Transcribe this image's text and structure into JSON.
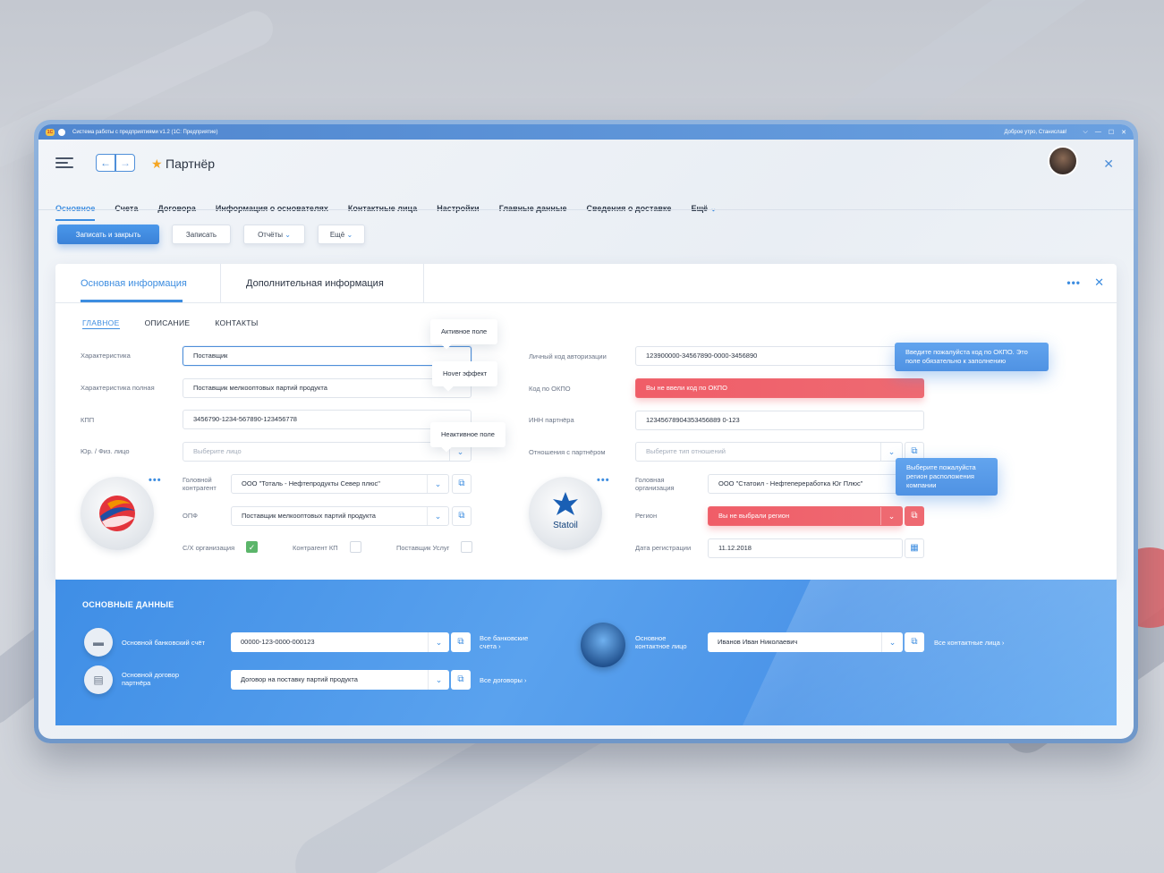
{
  "titlebar": {
    "logo": "1C",
    "title": "Система работы с предприятиями v1.2 (1С: Предприятие)",
    "greeting": "Доброе утро, Станислав!",
    "controls": [
      "⌵",
      "—",
      "☐",
      "✕"
    ]
  },
  "header": {
    "title": "Партнёр",
    "icons": [
      "menu-icon",
      "back-arrow-icon",
      "forward-arrow-icon",
      "star-icon",
      "close-icon"
    ]
  },
  "tabs": [
    {
      "label": "Основное",
      "active": true
    },
    {
      "label": "Счета"
    },
    {
      "label": "Договора"
    },
    {
      "label": "Информация о основателях"
    },
    {
      "label": "Контактные лица"
    },
    {
      "label": "Настройки"
    },
    {
      "label": "Главные данные"
    },
    {
      "label": "Сведения о доставке"
    },
    {
      "label": "Ещё"
    }
  ],
  "toolbar": {
    "save_close": "Записать и закрыть",
    "save": "Записать",
    "reports": "Отчёты",
    "more": "Ещё"
  },
  "card": {
    "tabs": [
      "Основная информация",
      "Дополнительная информация"
    ],
    "subtabs": [
      "ГЛАВНОЕ",
      "ОПИСАНИЕ",
      "КОНТАКТЫ"
    ]
  },
  "left": {
    "characteristic_label": "Характеристика",
    "characteristic_value": "Поставщик",
    "characteristic_full_label": "Характеристика полная",
    "characteristic_full_value": "Поставщик мелкооптовых партий продукта",
    "kpp_label": "КПП",
    "kpp_value": "3456790-1234-567890-123456778",
    "entity_label": "Юр. / Физ. лицо",
    "entity_placeholder": "Выберите лицо",
    "head_label": "Головной контрагент",
    "head_value": "ООО \"Тоталь - Нефтепродукты Север плюс\"",
    "opf_label": "ОПФ",
    "opf_value": "Поставщик мелкооптовых партий продукта",
    "cb_agri": "С/Х организация",
    "cb_kp": "Контрагент КП",
    "cb_services": "Поставщик Услуг"
  },
  "tooltips": {
    "active": "Активное поле",
    "hover": "Hover эффект",
    "inactive": "Неактивное поле"
  },
  "right": {
    "auth_label": "Личный код авторизации",
    "auth_value": "123900000-34567890-0000-3456890",
    "okpo_label": "Код по ОКПО",
    "okpo_error": "Вы не ввели код по ОКПО",
    "okpo_tip": "Введите пожалуйста код по ОКПО. Это поле обязательно к заполнению",
    "inn_label": "ИНН партнёра",
    "inn_value": "12345678904353456889 0-123",
    "relation_label": "Отношения с партнёром",
    "relation_placeholder": "Выберите тип отношений",
    "org_label": "Головная организация",
    "org_value": "ООО \"Статоил - Нефтепереработка Юг Плюс\"",
    "region_tip": "Выберите пожалуйста регион расположения компании",
    "region_label": "Регион",
    "region_error": "Вы не выбрали регион",
    "date_label": "Дата регистрации",
    "date_value": "11.12.2018",
    "statoil": "Statoil"
  },
  "main_data": {
    "title": "ОСНОВНЫЕ ДАННЫЕ",
    "account_label": "Основной банковский счёт",
    "account_value": "00000-123-0000-000123",
    "all_accounts": "Все банковские счета",
    "contract_label": "Основной договор партнёра",
    "contract_value": "Договор на поставку партий продукта",
    "all_contracts": "Все договоры",
    "contact_label": "Основное контактное лицо",
    "contact_value": "Иванов Иван Николаевич",
    "all_contacts": "Все контактные лица"
  },
  "colors": {
    "accent": "#3d8de0",
    "error": "#ee6a72",
    "success": "#5bb56a"
  }
}
